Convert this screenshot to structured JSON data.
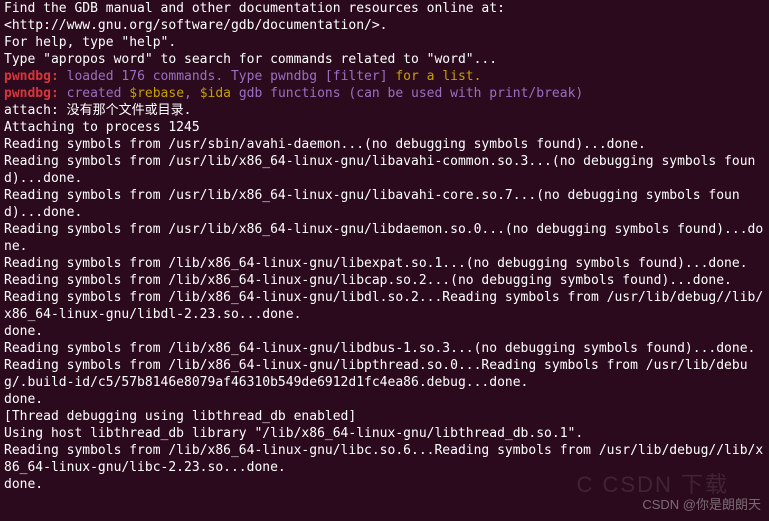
{
  "lines": [
    {
      "segments": [
        {
          "cls": "white",
          "text": "Find the GDB manual and other documentation resources online at:"
        }
      ]
    },
    {
      "segments": [
        {
          "cls": "white",
          "text": "<http://www.gnu.org/software/gdb/documentation/>."
        }
      ]
    },
    {
      "segments": [
        {
          "cls": "white",
          "text": "For help, type \"help\"."
        }
      ]
    },
    {
      "segments": [
        {
          "cls": "white",
          "text": "Type \"apropos word\" to search for commands related to \"word\"..."
        }
      ]
    },
    {
      "segments": [
        {
          "cls": "red",
          "text": "pwndbg: "
        },
        {
          "cls": "purple",
          "text": "loaded 176 commands. Type "
        },
        {
          "cls": "purple",
          "text": "pwndbg [filter] "
        },
        {
          "cls": "yellow",
          "text": "for a list."
        }
      ]
    },
    {
      "segments": [
        {
          "cls": "red",
          "text": "pwndbg: "
        },
        {
          "cls": "purple",
          "text": "created "
        },
        {
          "cls": "yellow",
          "text": "$rebase"
        },
        {
          "cls": "purple",
          "text": ", "
        },
        {
          "cls": "yellow",
          "text": "$ida "
        },
        {
          "cls": "purple",
          "text": "gdb functions (can be used with print/break)"
        }
      ]
    },
    {
      "segments": [
        {
          "cls": "white",
          "text": "attach: 没有那个文件或目录."
        }
      ]
    },
    {
      "segments": [
        {
          "cls": "white",
          "text": "Attaching to process 1245"
        }
      ]
    },
    {
      "segments": [
        {
          "cls": "white",
          "text": "Reading symbols from /usr/sbin/avahi-daemon...(no debugging symbols found)...done."
        }
      ]
    },
    {
      "segments": [
        {
          "cls": "white",
          "text": "Reading symbols from /usr/lib/x86_64-linux-gnu/libavahi-common.so.3...(no debugging symbols found)...done."
        }
      ]
    },
    {
      "segments": [
        {
          "cls": "white",
          "text": "Reading symbols from /usr/lib/x86_64-linux-gnu/libavahi-core.so.7...(no debugging symbols found)...done."
        }
      ]
    },
    {
      "segments": [
        {
          "cls": "white",
          "text": "Reading symbols from /usr/lib/x86_64-linux-gnu/libdaemon.so.0...(no debugging symbols found)...done."
        }
      ]
    },
    {
      "segments": [
        {
          "cls": "white",
          "text": "Reading symbols from /lib/x86_64-linux-gnu/libexpat.so.1...(no debugging symbols found)...done."
        }
      ]
    },
    {
      "segments": [
        {
          "cls": "white",
          "text": "Reading symbols from /lib/x86_64-linux-gnu/libcap.so.2...(no debugging symbols found)...done."
        }
      ]
    },
    {
      "segments": [
        {
          "cls": "white",
          "text": "Reading symbols from /lib/x86_64-linux-gnu/libdl.so.2...Reading symbols from /usr/lib/debug//lib/x86_64-linux-gnu/libdl-2.23.so...done."
        }
      ]
    },
    {
      "segments": [
        {
          "cls": "white",
          "text": "done."
        }
      ]
    },
    {
      "segments": [
        {
          "cls": "white",
          "text": "Reading symbols from /lib/x86_64-linux-gnu/libdbus-1.so.3...(no debugging symbols found)...done."
        }
      ]
    },
    {
      "segments": [
        {
          "cls": "white",
          "text": "Reading symbols from /lib/x86_64-linux-gnu/libpthread.so.0...Reading symbols from /usr/lib/debug/.build-id/c5/57b8146e8079af46310b549de6912d1fc4ea86.debug...done."
        }
      ]
    },
    {
      "segments": [
        {
          "cls": "white",
          "text": "done."
        }
      ]
    },
    {
      "segments": [
        {
          "cls": "white",
          "text": "[Thread debugging using libthread_db enabled]"
        }
      ]
    },
    {
      "segments": [
        {
          "cls": "white",
          "text": "Using host libthread_db library \"/lib/x86_64-linux-gnu/libthread_db.so.1\"."
        }
      ]
    },
    {
      "segments": [
        {
          "cls": "white",
          "text": "Reading symbols from /lib/x86_64-linux-gnu/libc.so.6...Reading symbols from /usr/lib/debug//lib/x86_64-linux-gnu/libc-2.23.so...done."
        }
      ]
    },
    {
      "segments": [
        {
          "cls": "white",
          "text": "done."
        }
      ]
    }
  ],
  "watermark": "CSDN @你是朗朗天",
  "watermark_ghost": "C CSDN 下载"
}
